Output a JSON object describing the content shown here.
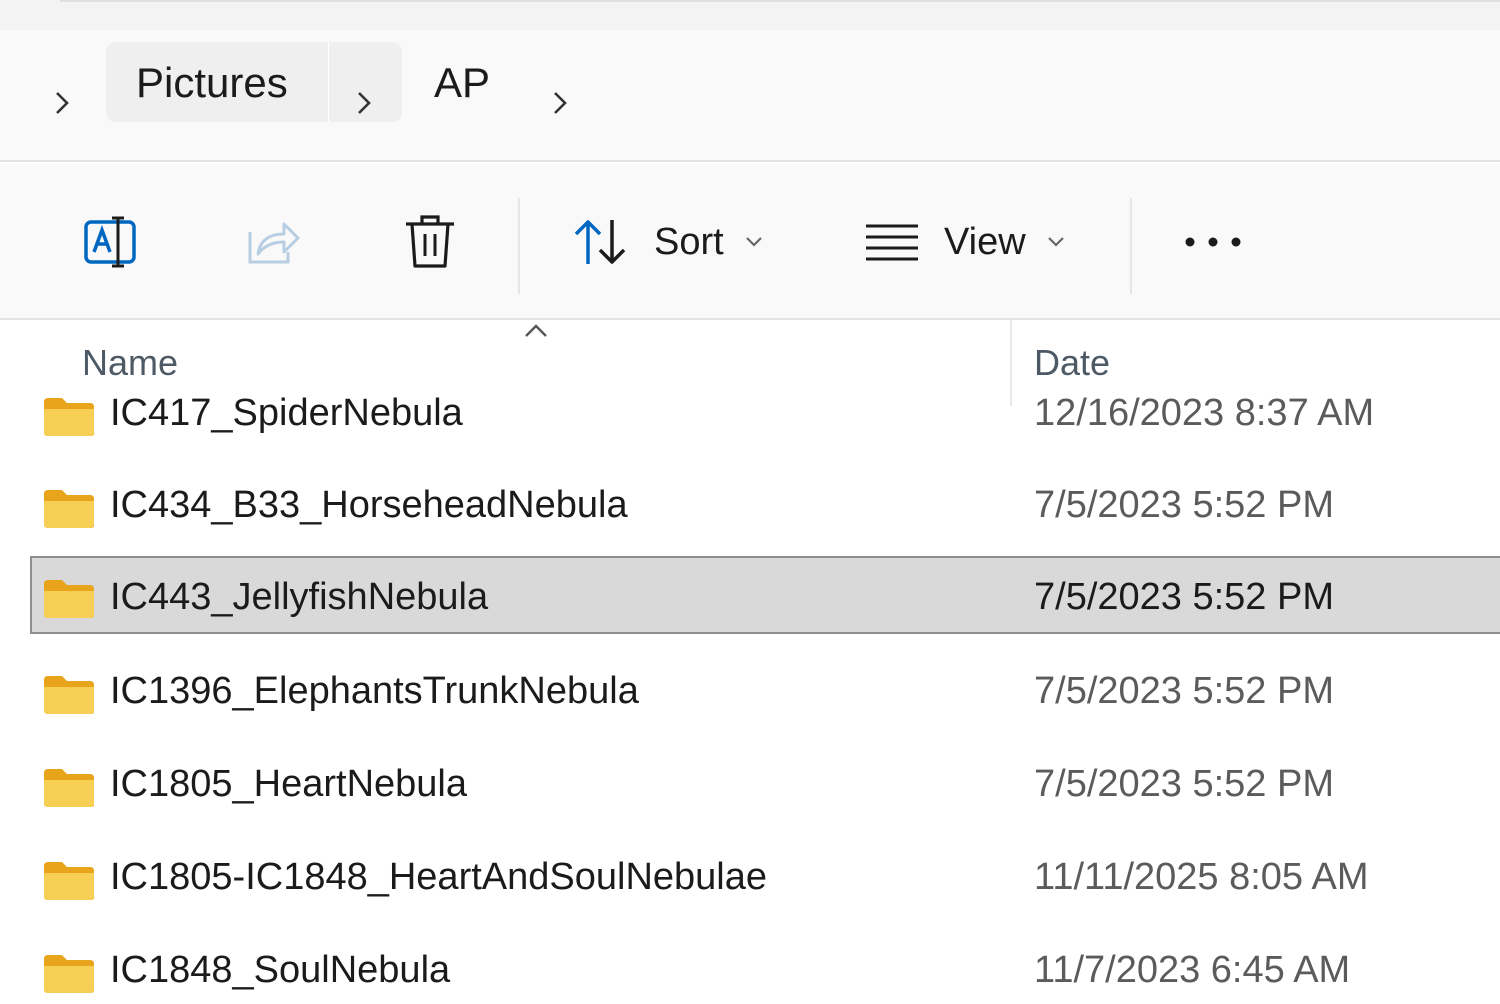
{
  "breadcrumb": {
    "items": [
      {
        "label": "Pictures"
      },
      {
        "label": "AP"
      }
    ]
  },
  "toolbar": {
    "rename_icon": "rename-icon",
    "share_icon": "share-icon",
    "delete_icon": "trash-icon",
    "sort_label": "Sort",
    "view_label": "View",
    "more_icon": "more-dots-icon"
  },
  "columns": {
    "name": "Name",
    "date": "Date"
  },
  "files": [
    {
      "name": "IC417_SpiderNebula",
      "date": "12/16/2023 8:37 AM"
    },
    {
      "name": "IC434_B33_HorseheadNebula",
      "date": "7/5/2023 5:52 PM"
    },
    {
      "name": "IC443_JellyfishNebula",
      "date": "7/5/2023 5:52 PM"
    },
    {
      "name": "IC1396_ElephantsTrunkNebula",
      "date": "7/5/2023 5:52 PM"
    },
    {
      "name": "IC1805_HeartNebula",
      "date": "7/5/2023 5:52 PM"
    },
    {
      "name": "IC1805-IC1848_HeartAndSoulNebulae",
      "date": "11/11/2025 8:05 AM"
    },
    {
      "name": "IC1848_SoulNebula",
      "date": "11/7/2023 6:45 AM"
    }
  ],
  "colors": {
    "folder": "#f5c242",
    "accent": "#0067c0",
    "selected_bg": "#d9d9d9"
  }
}
